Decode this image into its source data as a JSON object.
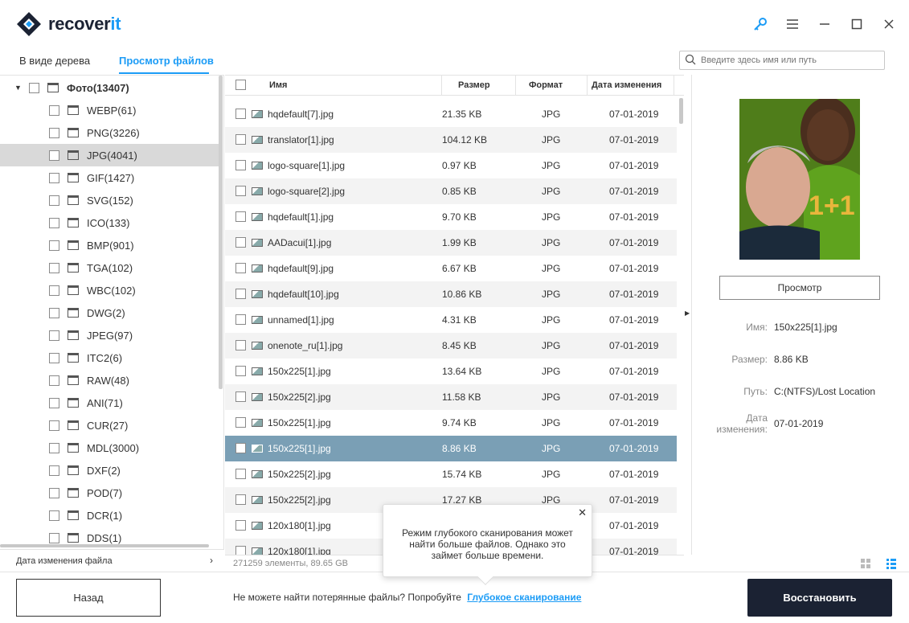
{
  "app": {
    "brand_main": "recover",
    "brand_accent": "it",
    "accent_color": "#1c9cf6",
    "dark_color": "#1b2233"
  },
  "window_controls": {
    "icons": [
      "key-icon",
      "menu-icon",
      "maximize-icon",
      "close-icon"
    ]
  },
  "tabs": [
    {
      "label": "В виде дерева",
      "active": false
    },
    {
      "label": "Просмотр файлов",
      "active": true
    }
  ],
  "search": {
    "placeholder": "Введите здесь имя или путь"
  },
  "tree": {
    "root": {
      "label": "Фото(13407)",
      "expanded": true
    },
    "items": [
      {
        "label": "WEBP(61)"
      },
      {
        "label": "PNG(3226)"
      },
      {
        "label": "JPG(4041)",
        "selected": true
      },
      {
        "label": "GIF(1427)"
      },
      {
        "label": "SVG(152)"
      },
      {
        "label": "ICO(133)"
      },
      {
        "label": "BMP(901)"
      },
      {
        "label": "TGA(102)"
      },
      {
        "label": "WBC(102)"
      },
      {
        "label": "DWG(2)"
      },
      {
        "label": "JPEG(97)"
      },
      {
        "label": "ITC2(6)"
      },
      {
        "label": "RAW(48)"
      },
      {
        "label": "ANI(71)"
      },
      {
        "label": "CUR(27)"
      },
      {
        "label": "MDL(3000)"
      },
      {
        "label": "DXF(2)"
      },
      {
        "label": "POD(7)"
      },
      {
        "label": "DCR(1)"
      },
      {
        "label": "DDS(1)"
      }
    ],
    "date_filter": "Дата изменения файла"
  },
  "table": {
    "headers": {
      "name": "Имя",
      "size": "Размер",
      "format": "Формат",
      "date": "Дата изменения"
    },
    "rows": [
      {
        "name": "hqdefault[7].jpg",
        "size": "21.35  KB",
        "format": "JPG",
        "date": "07-01-2019"
      },
      {
        "name": "translator[1].jpg",
        "size": "104.12  KB",
        "format": "JPG",
        "date": "07-01-2019"
      },
      {
        "name": "logo-square[1].jpg",
        "size": "0.97  KB",
        "format": "JPG",
        "date": "07-01-2019"
      },
      {
        "name": "logo-square[2].jpg",
        "size": "0.85  KB",
        "format": "JPG",
        "date": "07-01-2019"
      },
      {
        "name": "hqdefault[1].jpg",
        "size": "9.70  KB",
        "format": "JPG",
        "date": "07-01-2019"
      },
      {
        "name": "AADacui[1].jpg",
        "size": "1.99  KB",
        "format": "JPG",
        "date": "07-01-2019"
      },
      {
        "name": "hqdefault[9].jpg",
        "size": "6.67  KB",
        "format": "JPG",
        "date": "07-01-2019"
      },
      {
        "name": "hqdefault[10].jpg",
        "size": "10.86  KB",
        "format": "JPG",
        "date": "07-01-2019"
      },
      {
        "name": "unnamed[1].jpg",
        "size": "4.31  KB",
        "format": "JPG",
        "date": "07-01-2019"
      },
      {
        "name": "onenote_ru[1].jpg",
        "size": "8.45  KB",
        "format": "JPG",
        "date": "07-01-2019"
      },
      {
        "name": "150x225[1].jpg",
        "size": "13.64  KB",
        "format": "JPG",
        "date": "07-01-2019"
      },
      {
        "name": "150x225[2].jpg",
        "size": "11.58  KB",
        "format": "JPG",
        "date": "07-01-2019"
      },
      {
        "name": "150x225[1].jpg",
        "size": "9.74  KB",
        "format": "JPG",
        "date": "07-01-2019"
      },
      {
        "name": "150x225[1].jpg",
        "size": "8.86  KB",
        "format": "JPG",
        "date": "07-01-2019",
        "selected": true
      },
      {
        "name": "150x225[2].jpg",
        "size": "15.74  KB",
        "format": "JPG",
        "date": "07-01-2019"
      },
      {
        "name": "150x225[2].jpg",
        "size": "17.27  KB",
        "format": "JPG",
        "date": "07-01-2019"
      },
      {
        "name": "120x180[1].jpg",
        "size": "",
        "format": "",
        "date": "07-01-2019"
      },
      {
        "name": "120x180[1].jpg",
        "size": "",
        "format": "",
        "date": "07-01-2019"
      }
    ],
    "status": "271259 элементы, 89.65  GB"
  },
  "preview": {
    "image_caption": "1+1",
    "button": "Просмотр",
    "labels": {
      "name": "Имя:",
      "size": "Размер:",
      "path": "Путь:",
      "date_line1": "Дата",
      "date_line2": "изменения:"
    },
    "values": {
      "name": "150x225[1].jpg",
      "size": "8.86  KB",
      "path": "C:(NTFS)/Lost Location",
      "date": "07-01-2019"
    }
  },
  "popup": {
    "text": "Режим глубокого сканирования может найти больше файлов. Однако это займет больше времени."
  },
  "bottom": {
    "back": "Назад",
    "hint": "Не можете найти потерянные файлы? Попробуйте",
    "link": "Глубокое сканирование",
    "recover": "Восстановить"
  }
}
